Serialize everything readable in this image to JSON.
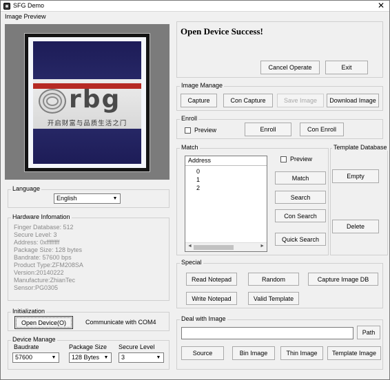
{
  "window": {
    "title": "SFG Demo",
    "close_glyph": "✕"
  },
  "preview": {
    "label": "Image Preview",
    "logo_letters": "rbg",
    "logo_chinese": "开启财富与品质生活之门"
  },
  "status": {
    "message": "Open Device Success!"
  },
  "top_buttons": {
    "cancel": "Cancel Operate",
    "exit": "Exit"
  },
  "image_manage": {
    "title": "Image Manage",
    "capture": "Capture",
    "con_capture": "Con Capture",
    "save_image": "Save Image",
    "download_image": "Download Image"
  },
  "enroll": {
    "title": "Enroll",
    "preview_label": "Preview",
    "enroll": "Enroll",
    "con_enroll": "Con Enroll"
  },
  "match": {
    "title": "Match",
    "list_header": "Address",
    "rows": [
      "0",
      "1",
      "2"
    ],
    "preview_label": "Preview",
    "match": "Match",
    "search": "Search",
    "con_search": "Con Search",
    "quick_search": "Quick Search",
    "scroll_left": "◄",
    "scroll_right": "►"
  },
  "template_db": {
    "title": "Template Database",
    "empty": "Empty",
    "delete": "Delete"
  },
  "language": {
    "title": "Language",
    "selected": "English"
  },
  "hardware": {
    "title": "Hardware Infomation",
    "lines": [
      "Finger Database: 512",
      "Secure Level: 3",
      "Address: 0xffffffff",
      "Package Size: 128 bytes",
      "Bandrate: 57600 bps",
      "Product Type:ZFM208SA",
      "Version:20140222",
      "Manufacture:ZhianTec",
      "Sensor:PG0305"
    ]
  },
  "special": {
    "title": "Special",
    "read_notepad": "Read Notepad",
    "random": "Random",
    "capture_image_db": "Capture Image DB",
    "write_notepad": "Write Notepad",
    "valid_template": "Valid Template"
  },
  "initialization": {
    "title": "Initialization",
    "open_device": "Open Device(O)",
    "comm_text": "Communicate with COM4"
  },
  "device_manage": {
    "title": "Device Manage",
    "baudrate_label": "Baudrate",
    "baudrate_value": "57600",
    "package_label": "Package Size",
    "package_value": "128 Bytes",
    "secure_label": "Secure Level",
    "secure_value": "3"
  },
  "deal_image": {
    "title": "Deal with Image",
    "path_value": "",
    "path": "Path",
    "source": "Source",
    "bin_image": "Bin Image",
    "thin_image": "Thin Image",
    "template_image": "Template Image"
  },
  "dropdown_glyph": "▼"
}
